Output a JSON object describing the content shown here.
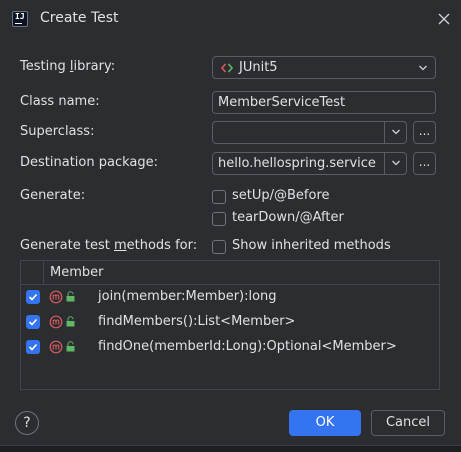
{
  "window": {
    "title": "Create Test",
    "app_icon_text": "IJ"
  },
  "form": {
    "testing_library_label_pre": "Testing ",
    "testing_library_label_u": "l",
    "testing_library_label_post": "ibrary:",
    "testing_library_value": "JUnit5",
    "class_name_label": "Class name:",
    "class_name_value": "MemberServiceTest",
    "superclass_label": "Superclass:",
    "superclass_value": "",
    "destination_label": "Destination package:",
    "destination_value": "hello.hellospring.service",
    "browse_label": "...",
    "generate_label": "Generate:",
    "setup_label": "setUp/@Before",
    "setup_checked": false,
    "teardown_label": "tearDown/@After",
    "teardown_checked": false,
    "methods_label_pre": "Generate test ",
    "methods_label_u": "m",
    "methods_label_post": "ethods for:",
    "inherited_label": "Show inherited methods",
    "inherited_checked": false
  },
  "table": {
    "column_header": "Member",
    "rows": [
      {
        "name": "join(member:Member):long",
        "checked": true
      },
      {
        "name": "findMembers():List<Member>",
        "checked": true
      },
      {
        "name": "findOne(memberId:Long):Optional<Member>",
        "checked": true
      }
    ]
  },
  "buttons": {
    "help": "?",
    "ok": "OK",
    "cancel": "Cancel"
  },
  "colors": {
    "background": "#2b2d30",
    "accent": "#3574f0",
    "method_icon": "#db5c5c",
    "access_icon": "#5fb865"
  },
  "icons": {
    "close": "close-icon",
    "dropdown": "chevron-down-icon",
    "library": "junit-icon",
    "method": "method-icon",
    "access": "lock-icon",
    "help": "help-icon"
  }
}
